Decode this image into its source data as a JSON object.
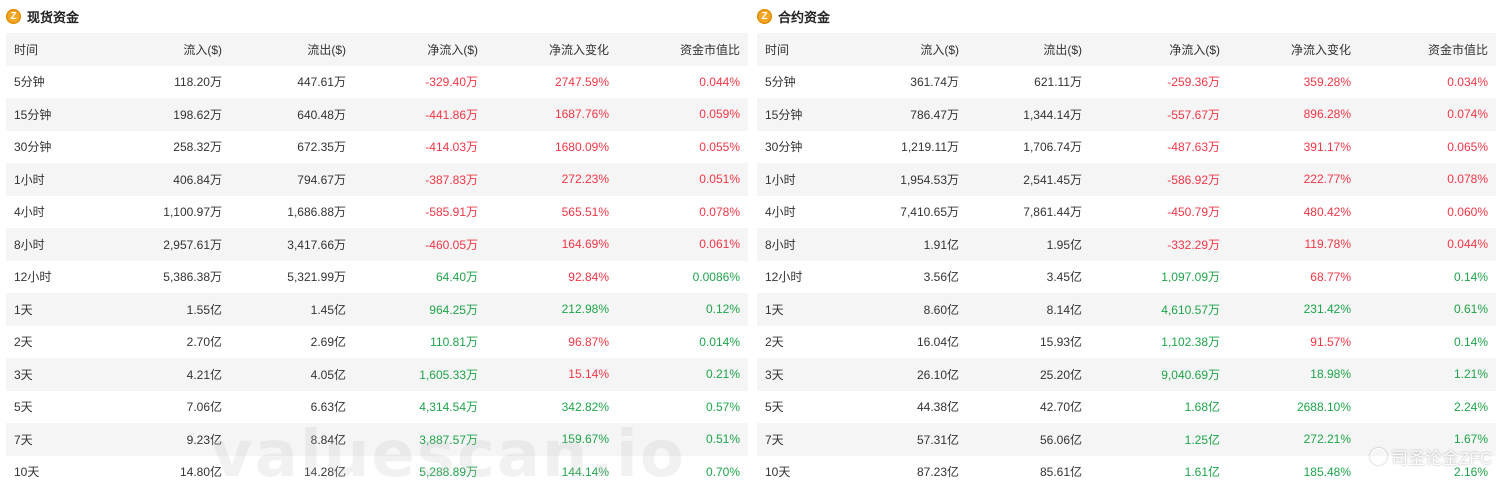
{
  "colors": {
    "negative": "#f23645",
    "positive": "#1ea44a",
    "stripe": "#f5f5f5",
    "coin": "#f5a623"
  },
  "panels": [
    {
      "title": "现货资金",
      "icon": "coin-icon",
      "headers": [
        "时间",
        "流入($)",
        "流出($)",
        "净流入($)",
        "净流入变化",
        "资金市值比"
      ],
      "rows": [
        {
          "cells": [
            "5分钟",
            "118.20万",
            "447.61万",
            "-329.40万",
            "2747.59%",
            "0.044%"
          ],
          "tones": [
            "",
            "",
            "",
            "neg",
            "neg",
            "neg"
          ]
        },
        {
          "cells": [
            "15分钟",
            "198.62万",
            "640.48万",
            "-441.86万",
            "1687.76%",
            "0.059%"
          ],
          "tones": [
            "",
            "",
            "",
            "neg",
            "neg",
            "neg"
          ]
        },
        {
          "cells": [
            "30分钟",
            "258.32万",
            "672.35万",
            "-414.03万",
            "1680.09%",
            "0.055%"
          ],
          "tones": [
            "",
            "",
            "",
            "neg",
            "neg",
            "neg"
          ]
        },
        {
          "cells": [
            "1小时",
            "406.84万",
            "794.67万",
            "-387.83万",
            "272.23%",
            "0.051%"
          ],
          "tones": [
            "",
            "",
            "",
            "neg",
            "neg",
            "neg"
          ]
        },
        {
          "cells": [
            "4小时",
            "1,100.97万",
            "1,686.88万",
            "-585.91万",
            "565.51%",
            "0.078%"
          ],
          "tones": [
            "",
            "",
            "",
            "neg",
            "neg",
            "neg"
          ]
        },
        {
          "cells": [
            "8小时",
            "2,957.61万",
            "3,417.66万",
            "-460.05万",
            "164.69%",
            "0.061%"
          ],
          "tones": [
            "",
            "",
            "",
            "neg",
            "neg",
            "neg"
          ]
        },
        {
          "cells": [
            "12小时",
            "5,386.38万",
            "5,321.99万",
            "64.40万",
            "92.84%",
            "0.0086%"
          ],
          "tones": [
            "",
            "",
            "",
            "pos",
            "neg",
            "pos"
          ]
        },
        {
          "cells": [
            "1天",
            "1.55亿",
            "1.45亿",
            "964.25万",
            "212.98%",
            "0.12%"
          ],
          "tones": [
            "",
            "",
            "",
            "pos",
            "pos",
            "pos"
          ]
        },
        {
          "cells": [
            "2天",
            "2.70亿",
            "2.69亿",
            "110.81万",
            "96.87%",
            "0.014%"
          ],
          "tones": [
            "",
            "",
            "",
            "pos",
            "neg",
            "pos"
          ]
        },
        {
          "cells": [
            "3天",
            "4.21亿",
            "4.05亿",
            "1,605.33万",
            "15.14%",
            "0.21%"
          ],
          "tones": [
            "",
            "",
            "",
            "pos",
            "neg",
            "pos"
          ]
        },
        {
          "cells": [
            "5天",
            "7.06亿",
            "6.63亿",
            "4,314.54万",
            "342.82%",
            "0.57%"
          ],
          "tones": [
            "",
            "",
            "",
            "pos",
            "pos",
            "pos"
          ]
        },
        {
          "cells": [
            "7天",
            "9.23亿",
            "8.84亿",
            "3,887.57万",
            "159.67%",
            "0.51%"
          ],
          "tones": [
            "",
            "",
            "",
            "pos",
            "pos",
            "pos"
          ]
        },
        {
          "cells": [
            "10天",
            "14.80亿",
            "14.28亿",
            "5,288.89万",
            "144.14%",
            "0.70%"
          ],
          "tones": [
            "",
            "",
            "",
            "pos",
            "pos",
            "pos"
          ]
        }
      ]
    },
    {
      "title": "合约资金",
      "icon": "coin-icon",
      "headers": [
        "时间",
        "流入($)",
        "流出($)",
        "净流入($)",
        "净流入变化",
        "资金市值比"
      ],
      "rows": [
        {
          "cells": [
            "5分钟",
            "361.74万",
            "621.11万",
            "-259.36万",
            "359.28%",
            "0.034%"
          ],
          "tones": [
            "",
            "",
            "",
            "neg",
            "neg",
            "neg"
          ]
        },
        {
          "cells": [
            "15分钟",
            "786.47万",
            "1,344.14万",
            "-557.67万",
            "896.28%",
            "0.074%"
          ],
          "tones": [
            "",
            "",
            "",
            "neg",
            "neg",
            "neg"
          ]
        },
        {
          "cells": [
            "30分钟",
            "1,219.11万",
            "1,706.74万",
            "-487.63万",
            "391.17%",
            "0.065%"
          ],
          "tones": [
            "",
            "",
            "",
            "neg",
            "neg",
            "neg"
          ]
        },
        {
          "cells": [
            "1小时",
            "1,954.53万",
            "2,541.45万",
            "-586.92万",
            "222.77%",
            "0.078%"
          ],
          "tones": [
            "",
            "",
            "",
            "neg",
            "neg",
            "neg"
          ]
        },
        {
          "cells": [
            "4小时",
            "7,410.65万",
            "7,861.44万",
            "-450.79万",
            "480.42%",
            "0.060%"
          ],
          "tones": [
            "",
            "",
            "",
            "neg",
            "neg",
            "neg"
          ]
        },
        {
          "cells": [
            "8小时",
            "1.91亿",
            "1.95亿",
            "-332.29万",
            "119.78%",
            "0.044%"
          ],
          "tones": [
            "",
            "",
            "",
            "neg",
            "neg",
            "neg"
          ]
        },
        {
          "cells": [
            "12小时",
            "3.56亿",
            "3.45亿",
            "1,097.09万",
            "68.77%",
            "0.14%"
          ],
          "tones": [
            "",
            "",
            "",
            "pos",
            "neg",
            "pos"
          ]
        },
        {
          "cells": [
            "1天",
            "8.60亿",
            "8.14亿",
            "4,610.57万",
            "231.42%",
            "0.61%"
          ],
          "tones": [
            "",
            "",
            "",
            "pos",
            "pos",
            "pos"
          ]
        },
        {
          "cells": [
            "2天",
            "16.04亿",
            "15.93亿",
            "1,102.38万",
            "91.57%",
            "0.14%"
          ],
          "tones": [
            "",
            "",
            "",
            "pos",
            "neg",
            "pos"
          ]
        },
        {
          "cells": [
            "3天",
            "26.10亿",
            "25.20亿",
            "9,040.69万",
            "18.98%",
            "1.21%"
          ],
          "tones": [
            "",
            "",
            "",
            "pos",
            "pos",
            "pos"
          ]
        },
        {
          "cells": [
            "5天",
            "44.38亿",
            "42.70亿",
            "1.68亿",
            "2688.10%",
            "2.24%"
          ],
          "tones": [
            "",
            "",
            "",
            "pos",
            "pos",
            "pos"
          ]
        },
        {
          "cells": [
            "7天",
            "57.31亿",
            "56.06亿",
            "1.25亿",
            "272.21%",
            "1.67%"
          ],
          "tones": [
            "",
            "",
            "",
            "pos",
            "pos",
            "pos"
          ]
        },
        {
          "cells": [
            "10天",
            "87.23亿",
            "85.61亿",
            "1.61亿",
            "185.48%",
            "2.16%"
          ],
          "tones": [
            "",
            "",
            "",
            "pos",
            "pos",
            "pos"
          ]
        }
      ]
    }
  ],
  "watermark": "valuescan.io",
  "wechat_mark": "司圣论金ZFC"
}
